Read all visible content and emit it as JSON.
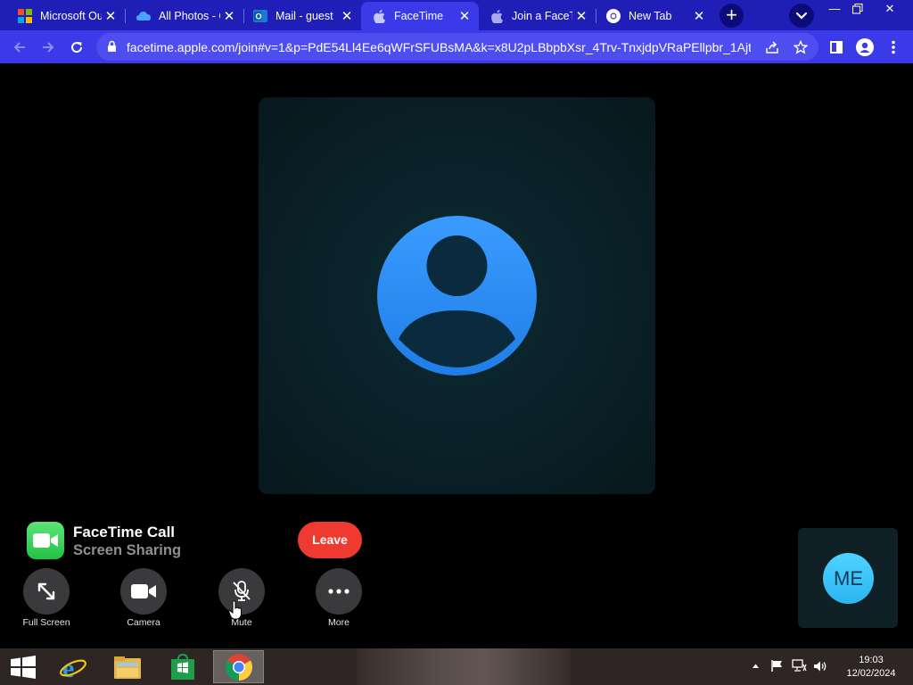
{
  "browser": {
    "tabs": [
      {
        "title": "Microsoft Ou",
        "icon": "microsoft-icon"
      },
      {
        "title": "All Photos - C",
        "icon": "onedrive-icon"
      },
      {
        "title": "Mail - guest",
        "icon": "outlook-icon"
      },
      {
        "title": "FaceTime",
        "icon": "apple-icon",
        "active": true
      },
      {
        "title": "Join a FaceTi",
        "icon": "apple-icon"
      },
      {
        "title": "New Tab",
        "icon": "chrome-icon"
      }
    ],
    "url": "facetime.apple.com/join#v=1&p=PdE54Ll4Ee6qWFrSFUBsMA&k=x8U2pLBbpbXsr_4Trv-TnxjdpVRaPEllpbr_1Ajtn..."
  },
  "call": {
    "title": "FaceTime Call",
    "subtitle": "Screen Sharing",
    "leave_label": "Leave",
    "controls": [
      {
        "label": "Full Screen",
        "icon": "fullscreen-icon"
      },
      {
        "label": "Camera",
        "icon": "camera-icon"
      },
      {
        "label": "Mute",
        "icon": "mic-muted-icon"
      },
      {
        "label": "More",
        "icon": "more-icon"
      }
    ],
    "self_initials": "ME"
  },
  "taskbar": {
    "time": "19:03",
    "date": "12/02/2024"
  },
  "colors": {
    "tabbar": "#1f1fb8",
    "toolbar": "#3a3ae8",
    "leave": "#ef3a30",
    "avatar_blue": "#2a8cf0",
    "self_avatar": "#3cc4f8"
  }
}
